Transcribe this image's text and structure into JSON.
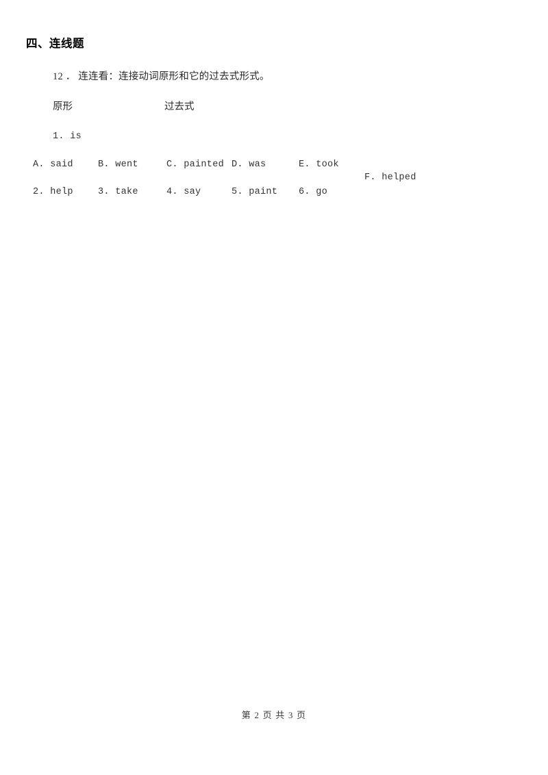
{
  "document": {
    "section_heading": "四、连线题",
    "question_stem": "12 ． 连连看：连接动词原形和它的过去式形式。",
    "column_headers": {
      "base_form": "原形",
      "past_form": "过去式"
    },
    "first_item": "1. is",
    "past_tense_options": [
      "A. said",
      "B. went",
      "C. painted",
      "D. was",
      "E. took"
    ],
    "offset_option": "F. helped",
    "base_form_items": [
      "2. help",
      "3. take",
      "4. say",
      "5. paint",
      "6. go"
    ],
    "footer": "第 2 页 共 3 页"
  }
}
